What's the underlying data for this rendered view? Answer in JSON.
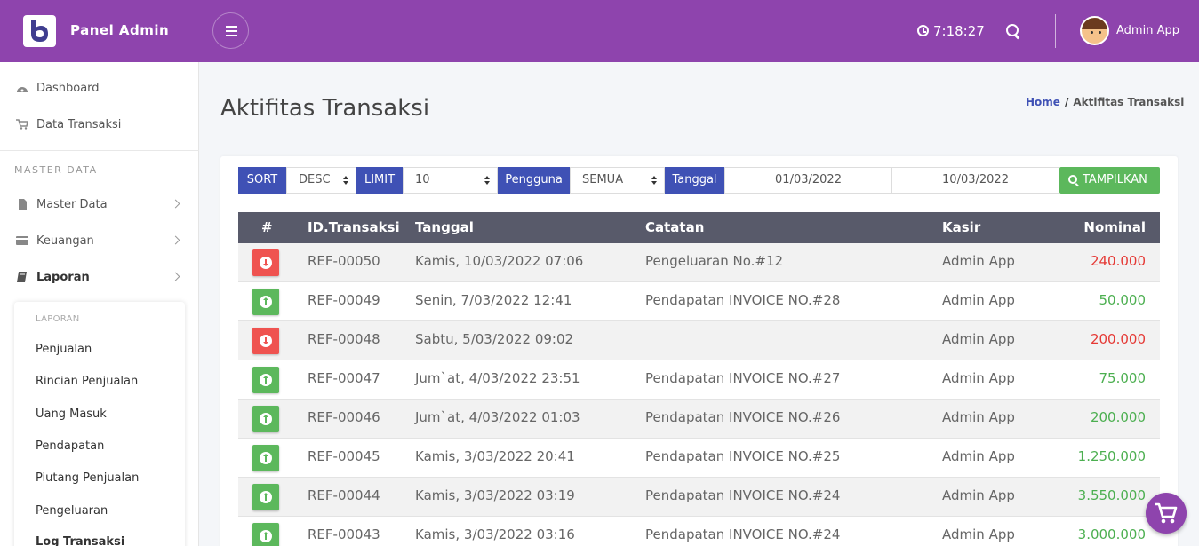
{
  "topbar": {
    "brand": "Panel Admin",
    "clock": "7:18:27",
    "user_name": "Admin App",
    "bg_color": "#8e44ad"
  },
  "sidebar": {
    "items": [
      {
        "label": "Dashboard",
        "icon": "dashboard-icon"
      },
      {
        "label": "Data Transaksi",
        "icon": "cart-icon"
      }
    ],
    "section_label": "MASTER DATA",
    "section_items": [
      {
        "label": "Master Data",
        "icon": "file-icon"
      },
      {
        "label": "Keuangan",
        "icon": "credit-card-icon"
      },
      {
        "label": "Laporan",
        "icon": "book-icon"
      }
    ],
    "submenu": {
      "header": "LAPORAN",
      "items": [
        "Penjualan",
        "Rincian Penjualan",
        "Uang Masuk",
        "Pendapatan",
        "Piutang Penjualan",
        "Pengeluaran",
        "Log Transaksi"
      ]
    }
  },
  "page": {
    "title": "Aktifitas Transaksi",
    "breadcrumb_home": "Home",
    "breadcrumb_sep": "/",
    "breadcrumb_current": "Aktifitas Transaksi"
  },
  "filters": {
    "sort_label": "SORT",
    "sort_value": "DESC",
    "limit_label": "LIMIT",
    "limit_value": "10",
    "user_label": "Pengguna",
    "user_value": "SEMUA",
    "date_label": "Tanggal",
    "date_from": "01/03/2022",
    "date_to": "10/03/2022",
    "submit_label": "TAMPILKAN"
  },
  "table": {
    "columns": [
      "#",
      "ID.Transaksi",
      "Tanggal",
      "Catatan",
      "Kasir",
      "Nominal"
    ],
    "rows": [
      {
        "dir": "out",
        "id": "REF-00050",
        "date": "Kamis, 10/03/2022 07:06",
        "note": "Pengeluaran No.#12",
        "cashier": "Admin App",
        "amount": "240.000"
      },
      {
        "dir": "in",
        "id": "REF-00049",
        "date": "Senin, 7/03/2022 12:41",
        "note": "Pendapatan INVOICE NO.#28",
        "cashier": "Admin App",
        "amount": "50.000"
      },
      {
        "dir": "out",
        "id": "REF-00048",
        "date": "Sabtu, 5/03/2022 09:02",
        "note": "",
        "cashier": "Admin App",
        "amount": "200.000"
      },
      {
        "dir": "in",
        "id": "REF-00047",
        "date": "Jum`at, 4/03/2022 23:51",
        "note": "Pendapatan INVOICE NO.#27",
        "cashier": "Admin App",
        "amount": "75.000"
      },
      {
        "dir": "in",
        "id": "REF-00046",
        "date": "Jum`at, 4/03/2022 01:03",
        "note": "Pendapatan INVOICE NO.#26",
        "cashier": "Admin App",
        "amount": "200.000"
      },
      {
        "dir": "in",
        "id": "REF-00045",
        "date": "Kamis, 3/03/2022 20:41",
        "note": "Pendapatan INVOICE NO.#25",
        "cashier": "Admin App",
        "amount": "1.250.000"
      },
      {
        "dir": "in",
        "id": "REF-00044",
        "date": "Kamis, 3/03/2022 03:19",
        "note": "Pendapatan INVOICE NO.#24",
        "cashier": "Admin App",
        "amount": "3.550.000"
      },
      {
        "dir": "in",
        "id": "REF-00043",
        "date": "Kamis, 3/03/2022 03:16",
        "note": "Pendapatan INVOICE NO.#24",
        "cashier": "Admin App",
        "amount": "3.000.000"
      }
    ]
  },
  "colors": {
    "accent": "#3f51b5",
    "success": "#5cb85c",
    "danger": "#ef5350",
    "table_header": "#585a6a"
  }
}
